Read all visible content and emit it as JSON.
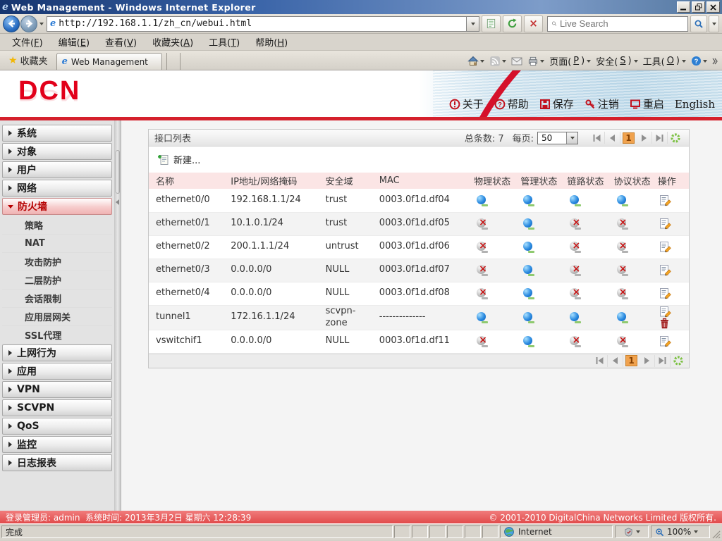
{
  "window": {
    "title": "Web Management - Windows Internet Explorer"
  },
  "browser": {
    "url": "http://192.168.1.1/zh_cn/webui.html",
    "search_placeholder": "Live Search",
    "menu_items": [
      {
        "id": "file",
        "text": "文件",
        "key": "F"
      },
      {
        "id": "edit",
        "text": "编辑",
        "key": "E"
      },
      {
        "id": "view",
        "text": "查看",
        "key": "V"
      },
      {
        "id": "favorites",
        "text": "收藏夹",
        "key": "A"
      },
      {
        "id": "tools",
        "text": "工具",
        "key": "T"
      },
      {
        "id": "help",
        "text": "帮助",
        "key": "H"
      }
    ],
    "favorites_label": "收藏夹",
    "tab_title": "Web Management",
    "command_items": [
      {
        "id": "page",
        "text": "页面",
        "key": "P"
      },
      {
        "id": "safety",
        "text": "安全",
        "key": "S"
      },
      {
        "id": "tools",
        "text": "工具",
        "key": "O"
      }
    ],
    "status_text": "完成",
    "zone_text": "Internet",
    "zoom_text": "100%"
  },
  "app": {
    "logo_text": "DCN",
    "header_buttons": [
      {
        "id": "about",
        "label": "关于"
      },
      {
        "id": "help",
        "label": "帮助"
      },
      {
        "id": "save",
        "label": "保存"
      },
      {
        "id": "logout",
        "label": "注销"
      },
      {
        "id": "reboot",
        "label": "重启"
      },
      {
        "id": "english",
        "label": "English"
      }
    ],
    "sidebar": [
      {
        "id": "system",
        "label": "系统",
        "expanded": false
      },
      {
        "id": "object",
        "label": "对象",
        "expanded": false
      },
      {
        "id": "user",
        "label": "用户",
        "expanded": false
      },
      {
        "id": "network",
        "label": "网络",
        "expanded": false
      },
      {
        "id": "firewall",
        "label": "防火墙",
        "expanded": true,
        "children": [
          {
            "id": "policy",
            "label": "策略"
          },
          {
            "id": "nat",
            "label": "NAT"
          },
          {
            "id": "attack-defense",
            "label": "攻击防护"
          },
          {
            "id": "l2-protection",
            "label": "二层防护"
          },
          {
            "id": "session-limit",
            "label": "会话限制"
          },
          {
            "id": "alg",
            "label": "应用层网关"
          },
          {
            "id": "ssl-proxy",
            "label": "SSL代理"
          }
        ]
      },
      {
        "id": "net-behavior",
        "label": "上网行为",
        "expanded": false
      },
      {
        "id": "application",
        "label": "应用",
        "expanded": false
      },
      {
        "id": "vpn",
        "label": "VPN",
        "expanded": false
      },
      {
        "id": "scvpn",
        "label": "SCVPN",
        "expanded": false
      },
      {
        "id": "qos",
        "label": "QoS",
        "expanded": false
      },
      {
        "id": "monitor",
        "label": "监控",
        "expanded": false
      },
      {
        "id": "log-report",
        "label": "日志报表",
        "expanded": false
      }
    ],
    "panel": {
      "title": "接口列表",
      "total_label": "总条数: 7",
      "per_page_label": "每页:",
      "per_page_value": "50",
      "current_page": "1",
      "new_label": "新建...",
      "columns": [
        "名称",
        "IP地址/网络掩码",
        "安全域",
        "MAC",
        "物理状态",
        "管理状态",
        "链路状态",
        "协议状态",
        "操作"
      ],
      "rows": [
        {
          "name": "ethernet0/0",
          "ip": "192.168.1.1/24",
          "zone": "trust",
          "mac": "0003.0f1d.df04",
          "status": [
            "up",
            "up",
            "up",
            "up"
          ],
          "ops": [
            "edit"
          ]
        },
        {
          "name": "ethernet0/1",
          "ip": "10.1.0.1/24",
          "zone": "trust",
          "mac": "0003.0f1d.df05",
          "status": [
            "down",
            "up",
            "down",
            "down"
          ],
          "ops": [
            "edit"
          ]
        },
        {
          "name": "ethernet0/2",
          "ip": "200.1.1.1/24",
          "zone": "untrust",
          "mac": "0003.0f1d.df06",
          "status": [
            "down",
            "up",
            "down",
            "down"
          ],
          "ops": [
            "edit"
          ]
        },
        {
          "name": "ethernet0/3",
          "ip": "0.0.0.0/0",
          "zone": "NULL",
          "mac": "0003.0f1d.df07",
          "status": [
            "down",
            "up",
            "down",
            "down"
          ],
          "ops": [
            "edit"
          ]
        },
        {
          "name": "ethernet0/4",
          "ip": "0.0.0.0/0",
          "zone": "NULL",
          "mac": "0003.0f1d.df08",
          "status": [
            "down",
            "up",
            "down",
            "down"
          ],
          "ops": [
            "edit"
          ]
        },
        {
          "name": "tunnel1",
          "ip": "172.16.1.1/24",
          "zone": "scvpn-zone",
          "mac": "--------------",
          "status": [
            "up",
            "up",
            "up",
            "up"
          ],
          "ops": [
            "edit",
            "delete"
          ]
        },
        {
          "name": "vswitchif1",
          "ip": "0.0.0.0/0",
          "zone": "NULL",
          "mac": "0003.0f1d.df11",
          "status": [
            "down",
            "up",
            "down",
            "down"
          ],
          "ops": [
            "edit"
          ]
        }
      ]
    },
    "footer": {
      "left": "登录管理员: admin  系统时间: 2013年3月2日 星期六 12:28:39",
      "right": "© 2001-2010 DigitalChina Networks Limited 版权所有."
    }
  },
  "colors": {
    "accent_red": "#d5202c",
    "header_icon_red": "#c2121e",
    "table_header_bg": "#fbe5e5",
    "current_page_bg": "#f0a24e",
    "status_up_blue": "#2a8ae0",
    "status_down_x": "#c41414",
    "footer_red": "#e14b4b"
  }
}
